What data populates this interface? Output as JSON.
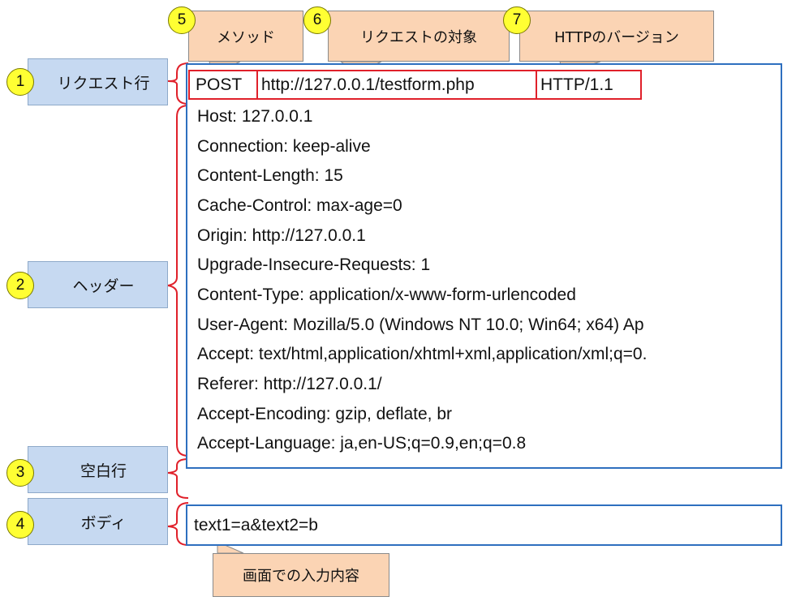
{
  "labels": [
    {
      "num": "1",
      "text": "リクエスト行"
    },
    {
      "num": "2",
      "text": "ヘッダー"
    },
    {
      "num": "3",
      "text": "空白行"
    },
    {
      "num": "4",
      "text": "ボディ"
    }
  ],
  "callouts": [
    {
      "num": "5",
      "text": "メソッド"
    },
    {
      "num": "6",
      "text": "リクエストの対象"
    },
    {
      "num": "7",
      "text": "HTTPのバージョン"
    }
  ],
  "request_line": {
    "method": "POST",
    "target": "http://127.0.0.1/testform.php",
    "version": "HTTP/1.1"
  },
  "headers": [
    "Host: 127.0.0.1",
    "Connection: keep-alive",
    "Content-Length: 15",
    "Cache-Control: max-age=0",
    "Origin: http://127.0.0.1",
    "Upgrade-Insecure-Requests: 1",
    "Content-Type: application/x-www-form-urlencoded",
    "User-Agent: Mozilla/5.0 (Windows NT 10.0; Win64; x64) Ap",
    "Accept: text/html,application/xhtml+xml,application/xml;q=0.",
    "Referer: http://127.0.0.1/",
    "Accept-Encoding: gzip, deflate, br",
    "Accept-Language: ja,en-US;q=0.9,en;q=0.8"
  ],
  "body_text": "text1=a&text2=b",
  "body_callout": "画面での入力内容",
  "colors": {
    "label_bg": "#c6d9f1",
    "callout_bg": "#fbd4b4",
    "badge": "#ffff33",
    "box_border": "#2e6fbf",
    "highlight": "#e0202a"
  }
}
